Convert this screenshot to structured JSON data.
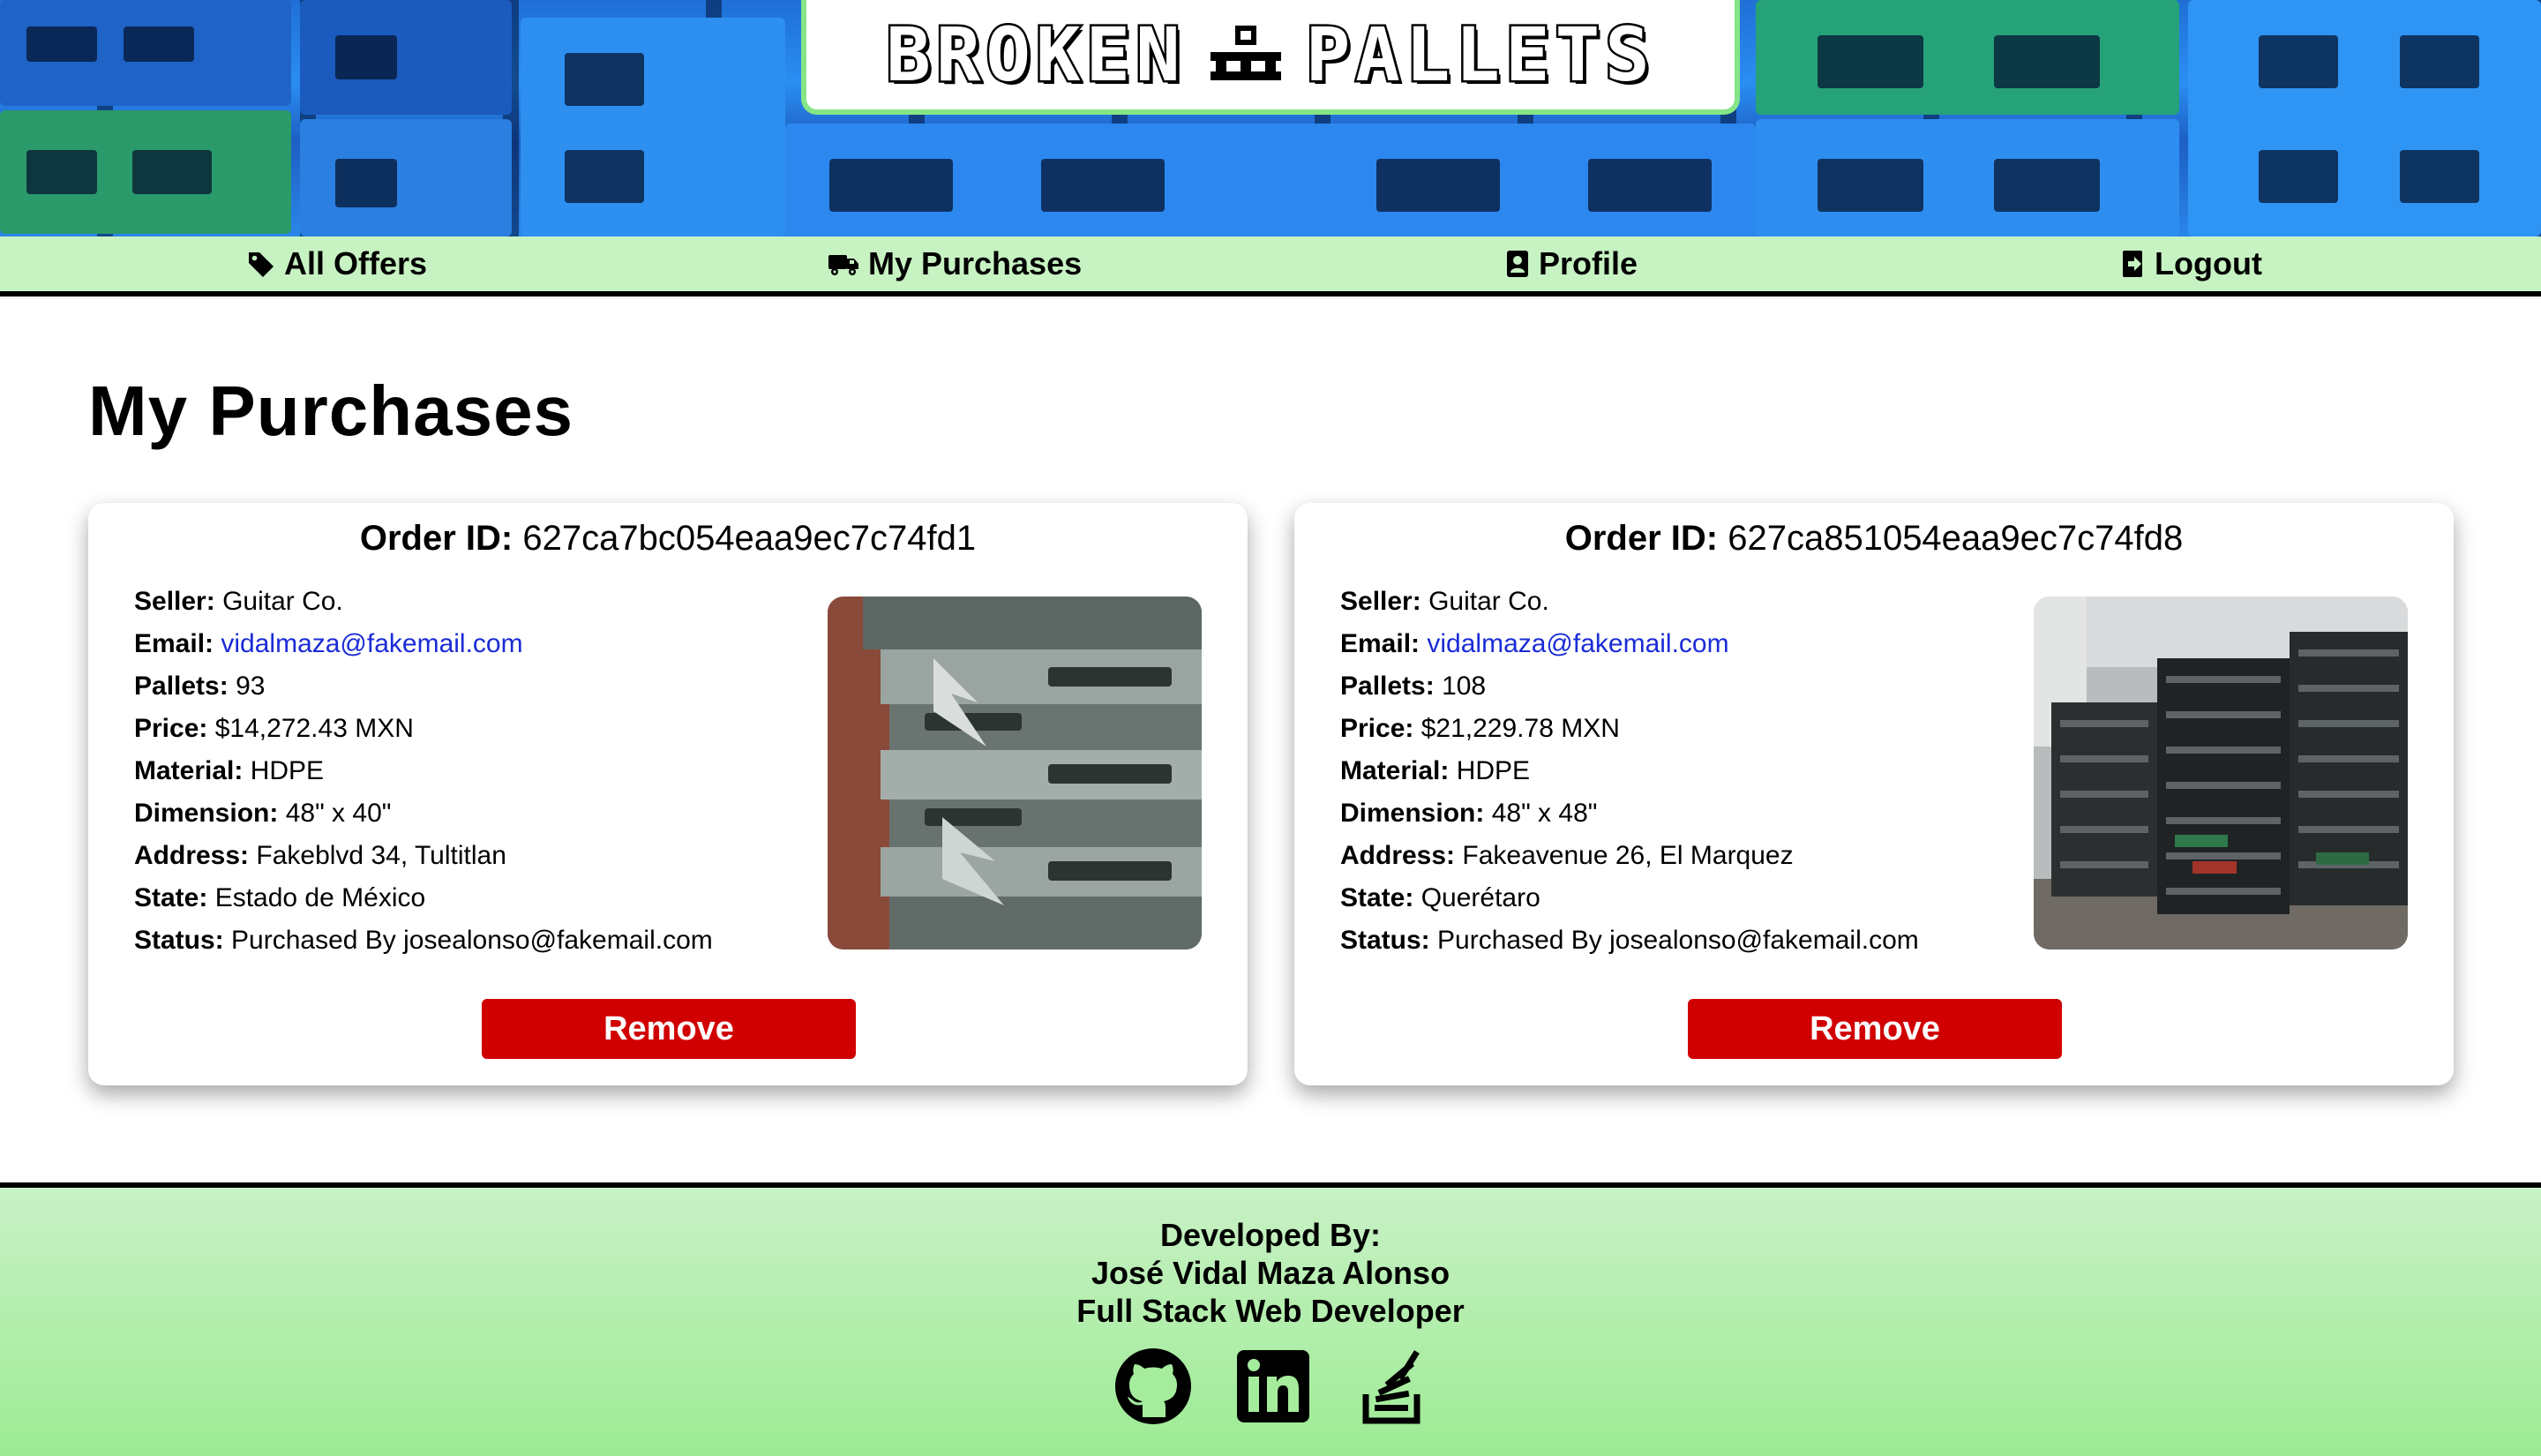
{
  "brand": {
    "word_left": "BROKEN",
    "word_right": "PALLETS",
    "logo_icon": "pallet-icon"
  },
  "nav": {
    "items": [
      {
        "label": "All Offers",
        "icon": "tag-icon"
      },
      {
        "label": "My Purchases",
        "icon": "truck-icon"
      },
      {
        "label": "Profile",
        "icon": "id-badge-icon"
      },
      {
        "label": "Logout",
        "icon": "logout-icon"
      }
    ]
  },
  "page": {
    "title": "My Purchases"
  },
  "labels": {
    "order_id": "Order ID:",
    "seller": "Seller:",
    "email": "Email:",
    "pallets": "Pallets:",
    "price": "Price:",
    "material": "Material:",
    "dimension": "Dimension:",
    "address": "Address:",
    "state": "State:",
    "status": "Status:",
    "remove": "Remove"
  },
  "orders": [
    {
      "order_id": "627ca7bc054eaa9ec7c74fd1",
      "seller": "Guitar Co.",
      "email": "vidalmaza@fakemail.com",
      "pallets": "93",
      "price": "$14,272.43 MXN",
      "material": "HDPE",
      "dimension": "48\" x 40\"",
      "address": "Fakeblvd 34, Tultitlan",
      "state": "Estado de México",
      "status": "Purchased By josealonso@fakemail.com"
    },
    {
      "order_id": "627ca851054eaa9ec7c74fd8",
      "seller": "Guitar Co.",
      "email": "vidalmaza@fakemail.com",
      "pallets": "108",
      "price": "$21,229.78 MXN",
      "material": "HDPE",
      "dimension": "48\" x 48\"",
      "address": "Fakeavenue 26, El Marquez",
      "state": "Querétaro",
      "status": "Purchased By josealonso@fakemail.com"
    }
  ],
  "footer": {
    "developed_by": "Developed By:",
    "name": "José Vidal Maza Alonso",
    "role": "Full Stack Web Developer",
    "socials": [
      "github-icon",
      "linkedin-icon",
      "stackoverflow-icon"
    ]
  },
  "colors": {
    "accent_green": "#c7f3c2",
    "remove_red": "#d10000",
    "link_blue": "#1a2bd6",
    "pallet_blue": "#2a8ef2",
    "pallet_green": "#2fa06a"
  }
}
